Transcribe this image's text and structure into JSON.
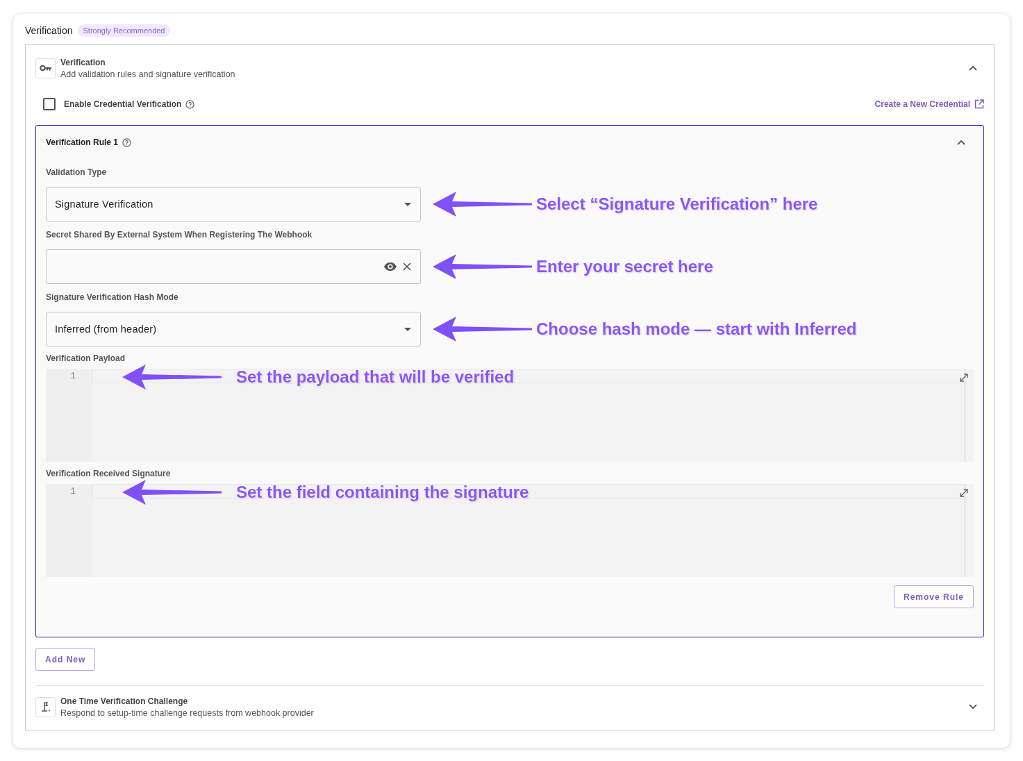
{
  "section_title": "Verification",
  "badge": "Strongly Recommended",
  "verification_panel": {
    "title": "Verification",
    "subtitle": "Add validation rules and signature verification",
    "expanded": true
  },
  "credential_checkbox": {
    "label": "Enable Credential Verification",
    "checked": false
  },
  "create_link": "Create a New Credential",
  "rules": [
    {
      "title": "Verification Rule 1",
      "expanded": true,
      "fields": [
        {
          "kind": "select",
          "label": "Validation Type",
          "value": "Signature Verification",
          "annotation": "Select “Signature Verification” here"
        },
        {
          "kind": "secret",
          "label": "Secret Shared By External System When Registering The Webhook",
          "annotation": "Enter your secret here"
        },
        {
          "kind": "select",
          "label": "Signature Verification Hash Mode",
          "value": "Inferred (from header)",
          "annotation": "Choose hash mode — start with Inferred"
        },
        {
          "kind": "code",
          "label": "Verification Payload",
          "line_number": "1",
          "annotation": "Set the payload that will be verified"
        },
        {
          "kind": "code",
          "label": "Verification Received Signature",
          "line_number": "1",
          "annotation": "Set the field containing the signature"
        }
      ],
      "remove_button": "Remove Rule"
    }
  ],
  "add_button": "Add New",
  "challenge_panel": {
    "title": "One Time Verification Challenge",
    "subtitle": "Respond to setup-time challenge requests from webhook provider",
    "expanded": false
  }
}
